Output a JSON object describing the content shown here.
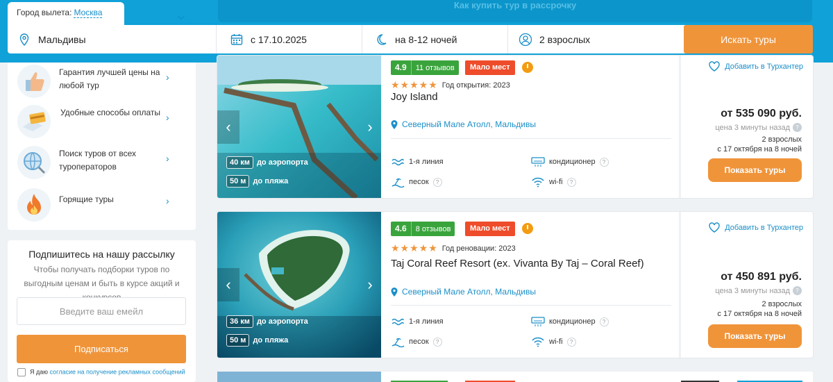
{
  "header": {
    "installment_label": "Как купить тур в рассрочку",
    "departure_label": "Город вылета:",
    "departure_city": "Москва"
  },
  "search": {
    "destination": "Мальдивы",
    "date": "с 17.10.2025",
    "nights": "на 8-12 ночей",
    "guests": "2 взрослых",
    "button": "Искать туры"
  },
  "sidebar": {
    "benefits": [
      {
        "label": "Гарантия лучшей цены на любой тур",
        "icon": "thumbs-up-icon"
      },
      {
        "label": "Удобные способы оплаты",
        "icon": "card-payment-icon"
      },
      {
        "label": "Поиск туров от всех туроператоров",
        "icon": "globe-search-icon"
      },
      {
        "label": "Горящие туры",
        "icon": "fire-icon"
      }
    ],
    "newsletter": {
      "title": "Подпишитесь на нашу рассылку",
      "description": "Чтобы получать подборки туров по выгодным ценам и быть в курсе акций и конкурсов",
      "placeholder": "Введите ваш емейл",
      "button": "Подписаться",
      "agree_text": "Я даю",
      "agree_link": "согласие на получение рекламных сообщений"
    }
  },
  "hotels": [
    {
      "rating": "4.9",
      "reviews": "11 отзывов",
      "badge": "Мало мест",
      "stars": 5,
      "year_label": "Год открытия: 2023",
      "name": "Joy Island",
      "location": "Северный Мале Атолл, Мальдивы",
      "airport_km": "40 км",
      "airport_label": "до аэропорта",
      "beach_m": "50 м",
      "beach_label": "до пляжа",
      "amenities": [
        "1-я линия",
        "кондиционер",
        "песок",
        "wi-fi"
      ],
      "favorite": "Добавить в Турхантер",
      "price": "от 535 090 руб.",
      "price_age": "цена 3 минуты назад",
      "guests": "2 взрослых",
      "dates": "с 17 октября на 8 ночей",
      "button": "Показать туры"
    },
    {
      "rating": "4.6",
      "reviews": "8 отзывов",
      "badge": "Мало мест",
      "stars": 5,
      "year_label": "Год реновации: 2023",
      "name": "Taj Coral Reef Resort (ex. Vivanta By Taj – Coral Reef)",
      "location": "Северный Мале Атолл, Мальдивы",
      "airport_km": "36 км",
      "airport_label": "до аэропорта",
      "beach_m": "50 м",
      "beach_label": "до пляжа",
      "amenities": [
        "1-я линия",
        "кондиционер",
        "песок",
        "wi-fi"
      ],
      "favorite": "Добавить в Турхантер",
      "price": "от 450 891 руб.",
      "price_age": "цена 3 минуты назад",
      "guests": "2 взрослых",
      "dates": "с 17 октября на 8 ночей",
      "button": "Показать туры"
    }
  ],
  "colors": {
    "brand_blue": "#0fa1d8",
    "accent_orange": "#f0943a",
    "rating_green": "#3aa43c",
    "badge_red": "#ee4c2a"
  }
}
